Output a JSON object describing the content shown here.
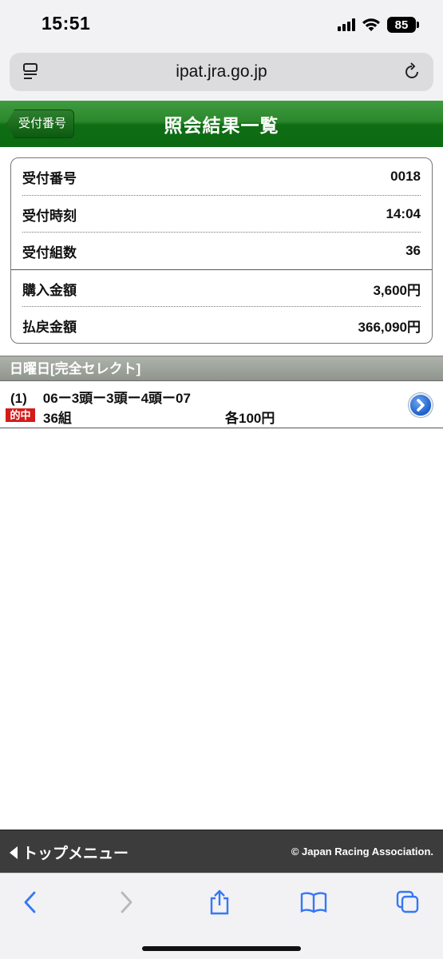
{
  "status_bar": {
    "time": "15:51",
    "battery": "85"
  },
  "browser": {
    "url": "ipat.jra.go.jp"
  },
  "header": {
    "back_label": "受付番号",
    "title": "照会結果一覧"
  },
  "summary": {
    "rows": [
      {
        "label": "受付番号",
        "value": "0018"
      },
      {
        "label": "受付時刻",
        "value": "14:04"
      },
      {
        "label": "受付組数",
        "value": "36"
      },
      {
        "label": "購入金額",
        "value": "3,600円"
      },
      {
        "label": "払戻金額",
        "value": "366,090円"
      }
    ]
  },
  "section": {
    "title": "日曜日[完全セレクト]"
  },
  "result": {
    "index": "(1)",
    "selection": "06ー3頭ー3頭ー4頭ー07",
    "badge": "的中",
    "combos": "36組",
    "each": "各100円"
  },
  "footer": {
    "top_menu": "トップメニュー",
    "copyright": "© Japan Racing Association."
  },
  "colors": {
    "header_green": "#0f6d14",
    "hit_red": "#d51a1a",
    "safari_blue": "#3478f6"
  }
}
